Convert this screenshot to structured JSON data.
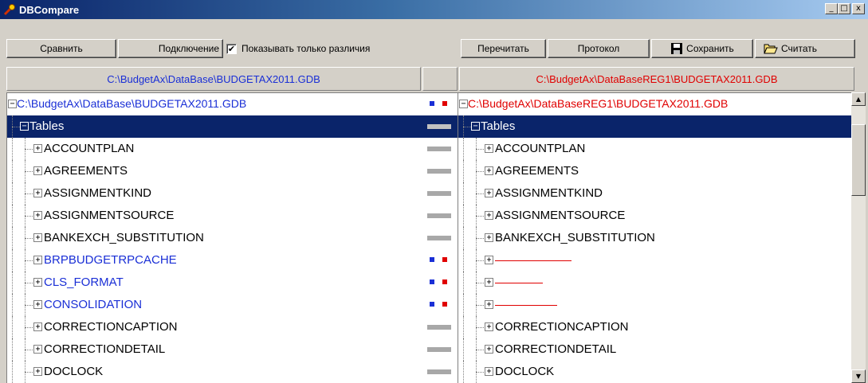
{
  "window": {
    "title": "DBCompare",
    "minimize_glyph": "_",
    "maximize_glyph": "□",
    "close_glyph": "x"
  },
  "toolbar": {
    "compare_label": "Сравнить",
    "connect_label": "Подключение",
    "show_diff_label": "Показывать только различия",
    "show_diff_checked": true,
    "check_mark": "✔",
    "reread_label": "Перечитать",
    "log_label": "Протокол",
    "save_label": "Сохранить",
    "load_label": "Считать"
  },
  "paths": {
    "left": "C:\\BudgetAx\\DataBase\\BUDGETAX2011.GDB",
    "right": "C:\\BudgetAx\\DataBaseREG1\\BUDGETAX2011.GDB"
  },
  "tree": {
    "root_left": "C:\\BudgetAx\\DataBase\\BUDGETAX2011.GDB",
    "root_right": "C:\\BudgetAx\\DataBaseREG1\\BUDGETAX2011.GDB",
    "tables_label": "Tables",
    "collapse_glyph": "−",
    "expand_glyph": "+",
    "items": [
      {
        "left": "ACCOUNTPLAN",
        "right": "ACCOUNTPLAN",
        "diff": false
      },
      {
        "left": "AGREEMENTS",
        "right": "AGREEMENTS",
        "diff": false
      },
      {
        "left": "ASSIGNMENTKIND",
        "right": "ASSIGNMENTKIND",
        "diff": false
      },
      {
        "left": "ASSIGNMENTSOURCE",
        "right": "ASSIGNMENTSOURCE",
        "diff": false
      },
      {
        "left": "BANKEXCH_SUBSTITUTION",
        "right": "BANKEXCH_SUBSTITUTION",
        "diff": false
      },
      {
        "left": "BRPBUDGETRPCACHE",
        "right": "",
        "diff": true
      },
      {
        "left": "CLS_FORMAT",
        "right": "",
        "diff": true
      },
      {
        "left": "CONSOLIDATION",
        "right": "",
        "diff": true
      },
      {
        "left": "CORRECTIONCAPTION",
        "right": "CORRECTIONCAPTION",
        "diff": false
      },
      {
        "left": "CORRECTIONDETAIL",
        "right": "CORRECTIONDETAIL",
        "diff": false
      },
      {
        "left": "DOCLOCK",
        "right": "DOCLOCK",
        "diff": false
      }
    ]
  },
  "colors": {
    "left_path": "#1a2fd6",
    "right_path": "#e00000",
    "selection": "#0a246a",
    "face": "#d4d0c8"
  },
  "scrollbar": {
    "up_glyph": "▲",
    "down_glyph": "▼"
  }
}
